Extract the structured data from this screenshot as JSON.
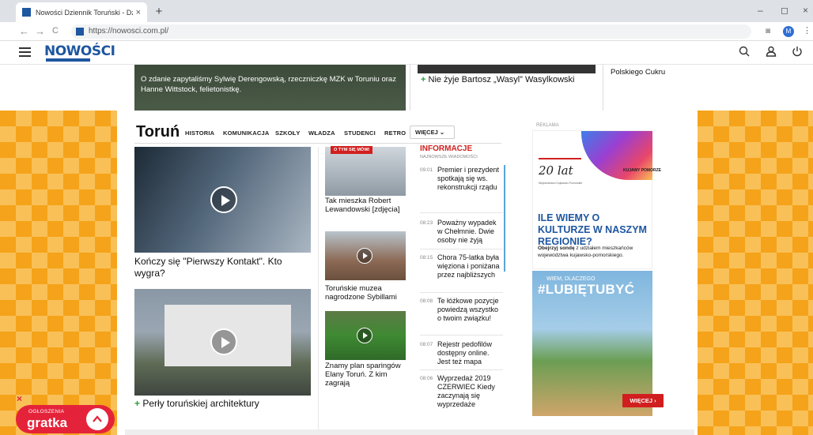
{
  "browser": {
    "tab_title": "Nowości Dziennik Toruński - Dzie",
    "tab_close": "×",
    "new_tab": "+",
    "url": "https://nowosci.com.pl/",
    "profile_initial": "M",
    "window_minimize": "–",
    "window_restore": "◻",
    "window_close": "×",
    "back": "←",
    "forward": "→",
    "reload": "C"
  },
  "header": {
    "logo": "NOWOŚCI",
    "icons": [
      "search-icon",
      "user-icon",
      "power-icon"
    ]
  },
  "top_row": {
    "left_caption": "O zdanie zapytaliśmy Sylwię Derengowską, rzeczniczkę MZK w Toruniu oraz Hanne Wittstock, felietonistkę.",
    "center_headline": "Nie żyje Bartosz „Wasyl” Wasylkowski",
    "right_text": "Polskiego Cukru"
  },
  "section": {
    "title": "Toruń",
    "nav": [
      "HISTORIA",
      "KOMUNIKACJA",
      "SZKOŁY",
      "WŁADZA",
      "STUDENCI",
      "RETRO"
    ],
    "more": "WIĘCEJ ⌄",
    "ad_label": "REKLAMA"
  },
  "big_items": [
    {
      "caption": "Kończy się \"Pierwszy Kontakt\". Kto wygra?"
    },
    {
      "caption": "Perły toruńskiej architektury"
    }
  ],
  "mid_items": [
    {
      "badge": "O TYM SIĘ MÓWI",
      "caption": "Tak mieszka Robert Lewandowski [zdjęcia]"
    },
    {
      "caption": "Toruńskie muzea nagrodzone Sybillami"
    },
    {
      "caption": "Znamy plan sparingów Elany Toruń. Z kim zagrają"
    }
  ],
  "informacje": {
    "title": "INFORMACJE",
    "subtitle": "NAJNOWSZE WIADOMOŚCI",
    "items": [
      {
        "time": "09:01",
        "headline": "Premier i prezydent spotkają się ws. rekonstrukcji rządu"
      },
      {
        "time": "08:23",
        "headline": "Poważny wypadek w Chełmnie. Dwie osoby nie żyją"
      },
      {
        "time": "08:15",
        "headline": "Chora 75-latka była więziona i poniżana przez najbliższych"
      },
      {
        "time": "08:08",
        "headline": "Te łóżkowe pozycje powiedzą wszystko o twoim związku!"
      },
      {
        "time": "08:07",
        "headline": "Rejestr pedofilów dostępny online. Jest też mapa"
      },
      {
        "time": "08:06",
        "headline": "Wyprzedaż 2019 CZERWIEC Kiedy zaczynają się wyprzedaże"
      }
    ]
  },
  "ad": {
    "brand": "KUJAWY POMORZE",
    "anniversary": "20 lat",
    "anniversary_sub": "Województwo Kujawsko-Pomorskie",
    "headline": "ILE WIEMY O KULTURZE W NASZYM REGIONIE?",
    "body_bold": "Obejrzyj sondę",
    "body": " z udziałem mieszkańców województwa kujawsko-pomorskiego.",
    "hashtag_top": "WIEM, DLACZEGO",
    "hashtag": "#LUBIĘTUBYĆ",
    "button": "WIĘCEJ  ›"
  },
  "gratka": {
    "label_top": "OGŁOSZENIA",
    "label": "gratka",
    "close": "×",
    "up": "^"
  },
  "colors": {
    "brand_blue": "#1e56a0",
    "accent_red": "#d11f1f",
    "checker_orange": "#f5a31a",
    "plus_green": "#2a9d3f"
  }
}
